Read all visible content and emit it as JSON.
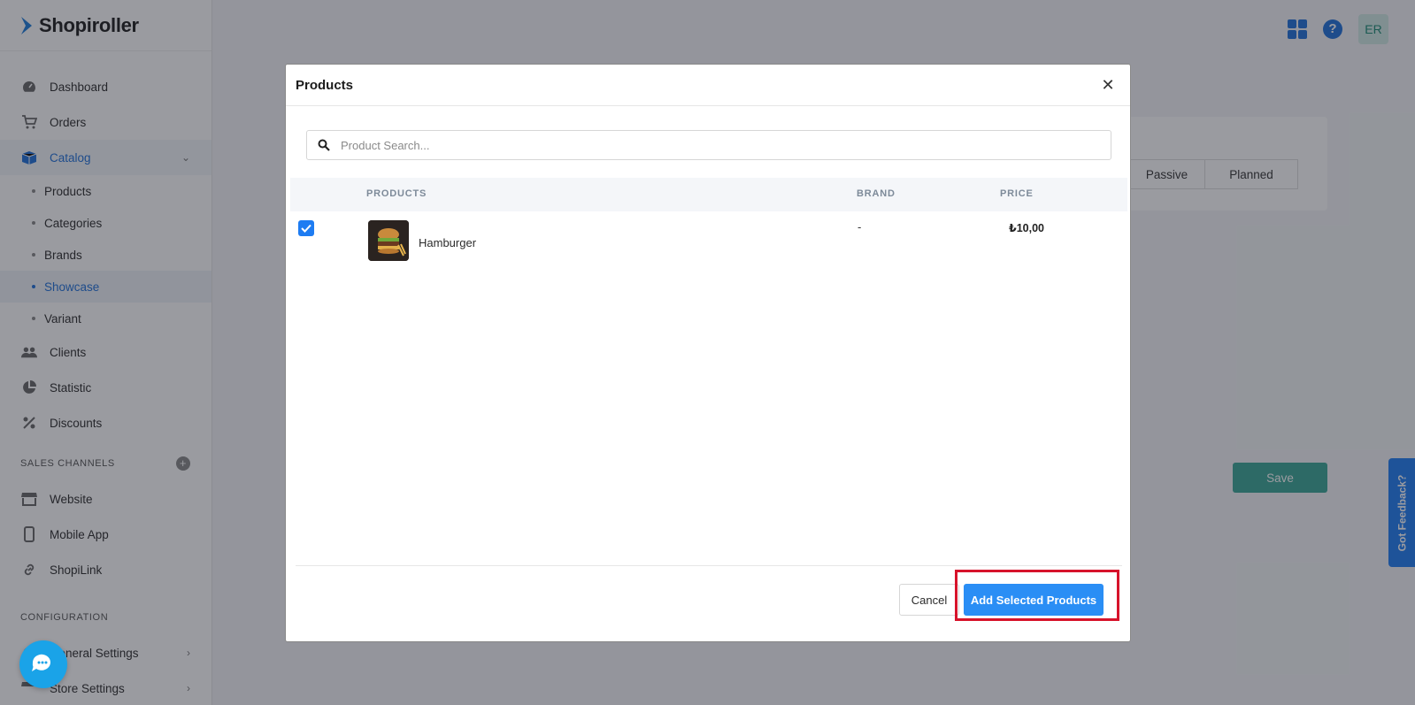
{
  "brand": {
    "name": "Shopiroller"
  },
  "sidebar": {
    "main": [
      {
        "label": "Dashboard",
        "icon": "dashboard-icon"
      },
      {
        "label": "Orders",
        "icon": "cart-icon"
      },
      {
        "label": "Catalog",
        "icon": "box-icon"
      }
    ],
    "catalog_sub": [
      {
        "label": "Products"
      },
      {
        "label": "Categories"
      },
      {
        "label": "Brands"
      },
      {
        "label": "Showcase"
      },
      {
        "label": "Variant"
      }
    ],
    "after": [
      {
        "label": "Clients",
        "icon": "users-icon"
      },
      {
        "label": "Statistic",
        "icon": "pie-chart-icon"
      },
      {
        "label": "Discounts",
        "icon": "percent-icon"
      }
    ],
    "sales_channels_title": "SALES CHANNELS",
    "sales_channels": [
      {
        "label": "Website",
        "icon": "store-icon"
      },
      {
        "label": "Mobile App",
        "icon": "phone-icon"
      },
      {
        "label": "ShopiLink",
        "icon": "link-icon"
      }
    ],
    "configuration_title": "CONFIGURATION",
    "configuration": [
      {
        "label": "General Settings",
        "icon": "gear-icon"
      },
      {
        "label": "Store Settings",
        "icon": "store-icon"
      }
    ]
  },
  "topbar": {
    "avatar_initials": "ER"
  },
  "background": {
    "segments": [
      "Passive",
      "Planned"
    ],
    "save_label": "Save",
    "feedback_label": "Got Feedback?"
  },
  "modal": {
    "title": "Products",
    "search_placeholder": "Product Search...",
    "columns": {
      "products": "PRODUCTS",
      "brand": "BRAND",
      "price": "PRICE"
    },
    "rows": [
      {
        "name": "Hamburger",
        "brand": "-",
        "price": "₺10,00",
        "checked": true
      }
    ],
    "cancel_label": "Cancel",
    "add_label": "Add Selected Products"
  },
  "colors": {
    "primary": "#1e7cf2",
    "save": "#3aa695",
    "highlight": "#d7132b"
  }
}
